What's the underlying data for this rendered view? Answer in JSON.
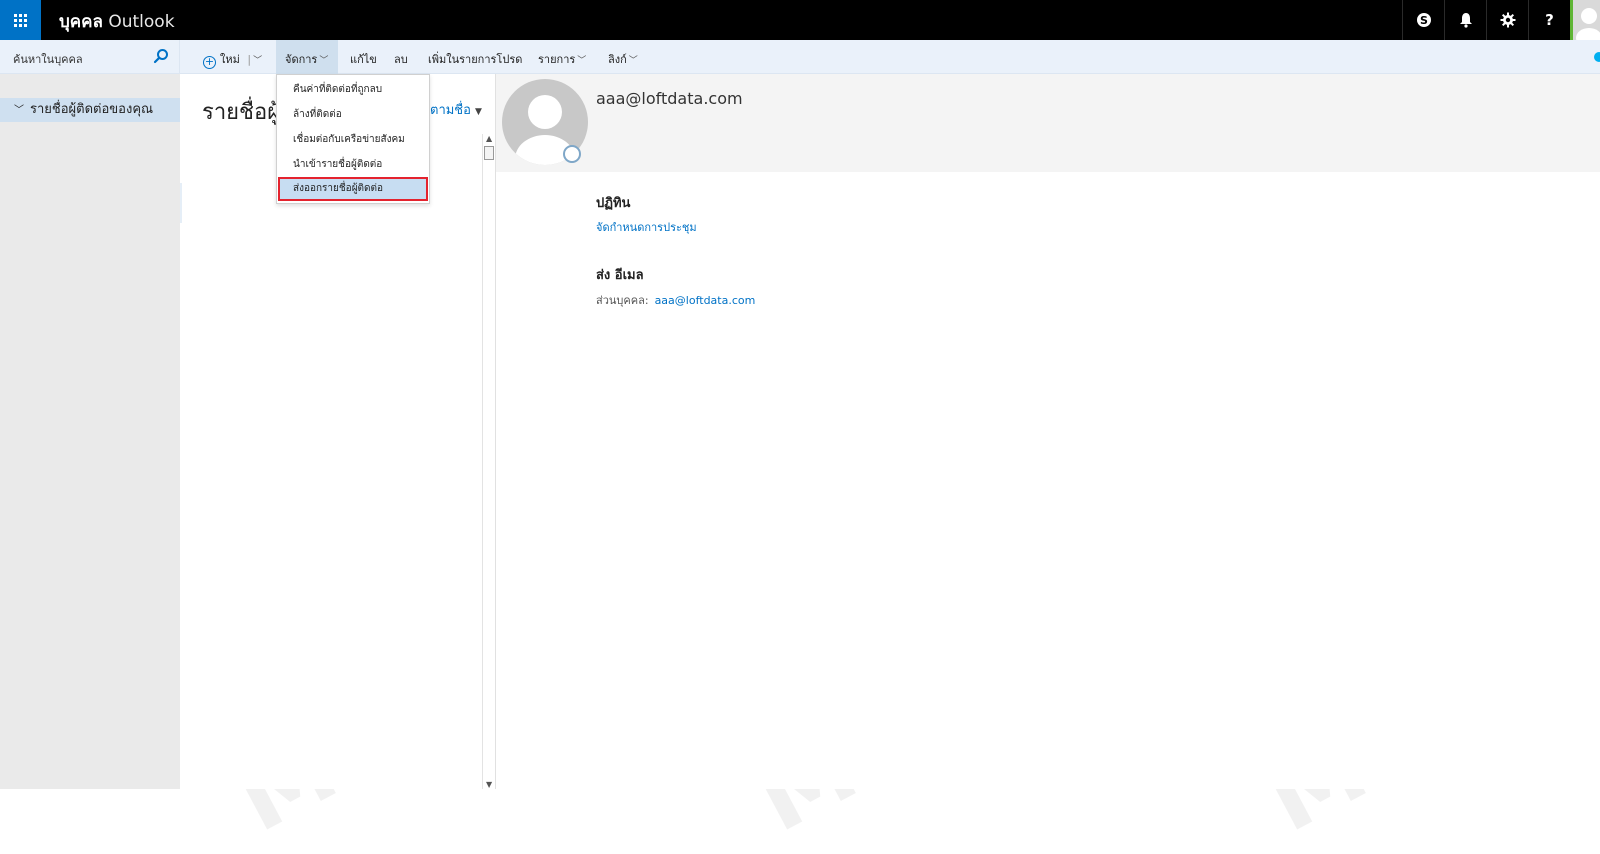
{
  "app": {
    "title_bold": "บุคคล",
    "title_light": "Outlook"
  },
  "topbar": {
    "icons": [
      "skype-icon",
      "bell-icon",
      "gear-icon",
      "help-icon"
    ],
    "help_label": "?"
  },
  "search": {
    "placeholder": "ค้นหาในบุคคล"
  },
  "commands": {
    "new": "ใหม่",
    "manage": "จัดการ",
    "edit": "แก้ไข",
    "delete": "ลบ",
    "add_favorites": "เพิ่มในรายการโปรด",
    "list": "รายการ",
    "link": "ลิงก์"
  },
  "nav": {
    "item": "รายชื่อผู้ติดต่อของคุณ"
  },
  "list": {
    "title": "รายชื่อผู้ติดต่อ",
    "sort_label": "ตามชื่อ"
  },
  "manage_menu": {
    "items": [
      "คืนค่าที่ติดต่อที่ถูกลบ",
      "ล้างที่ติดต่อ",
      "เชื่อมต่อกับเครือข่ายสังคม",
      "นำเข้ารายชื่อผู้ติดต่อ",
      "ส่งออกรายชื่อผู้ติดต่อ"
    ],
    "selected_index": 4
  },
  "contact": {
    "email": "aaa@loftdata.com",
    "calendar_title": "ปฏิทิน",
    "calendar_link": "จัดกำหนดการประชุม",
    "send_email_title": "ส่ง อีเมล",
    "personal_label": "ส่วนบุคคล:",
    "personal_email": "aaa@loftdata.com"
  },
  "colors": {
    "accent": "#0072c6",
    "topbar": "#000000",
    "highlight_border": "#e4232e"
  }
}
